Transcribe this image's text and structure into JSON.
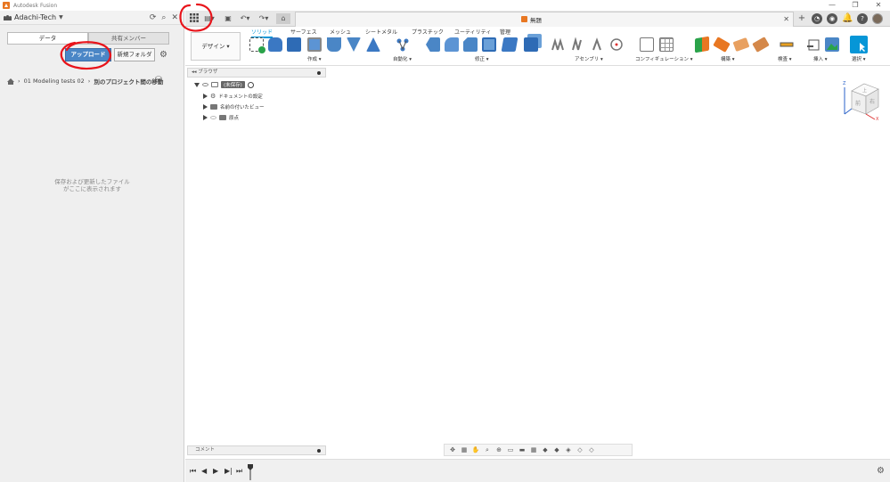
{
  "titlebar": {
    "app_title": "Autodesk Fusion",
    "minimize": "—",
    "restore": "❐",
    "close": "✕"
  },
  "left_panel": {
    "team_name": "Adachi-Tech",
    "tab_data": "データ",
    "tab_shared": "共有メンバー",
    "upload_label": "アップロード",
    "new_folder_label": "新規フォルダ",
    "breadcrumb_parent": "01 Modeling tests 02",
    "breadcrumb_project": "別のプロジェクト間の移動",
    "empty_message_line1": "保存および更新したファイル",
    "empty_message_line2": "がここに表示されます"
  },
  "document": {
    "title": "無題"
  },
  "ribbon": {
    "tabs": [
      "ソリッド",
      "サーフェス",
      "メッシュ",
      "シートメタル",
      "プラスチック",
      "ユーティリティ",
      "管理"
    ],
    "workspace_label": "デザイン ▾",
    "groups": [
      "作成 ▾",
      "自動化 ▾",
      "修正 ▾",
      "アセンブリ ▾",
      "コンフィギュレーション ▾",
      "構築 ▾",
      "検査 ▾",
      "挿入 ▾",
      "選択 ▾"
    ]
  },
  "browser": {
    "header": "ブラウザ",
    "root_label": "(未保存)",
    "items": [
      "ドキュメントの設定",
      "名前の付いたビュー",
      "原点"
    ]
  },
  "comments": {
    "label": "コメント"
  },
  "viewcube": {
    "top_face": "上",
    "front_face": "前",
    "right_face": "右",
    "axis_x": "X",
    "axis_z": "Z"
  },
  "colors": {
    "accent": "#0696d7",
    "upload_button": "#4a86c6",
    "annotation": "#e8141b"
  }
}
